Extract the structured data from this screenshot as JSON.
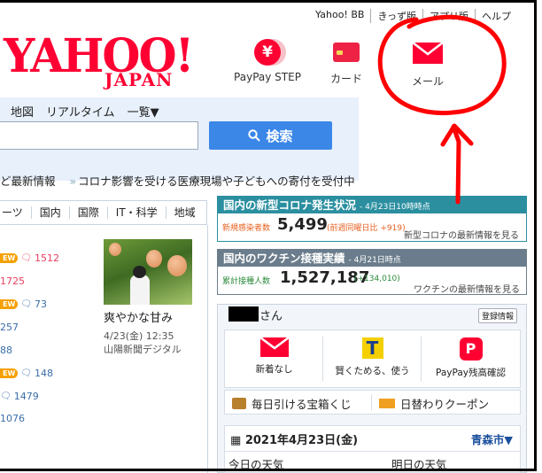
{
  "toplinks": [
    "Yahoo! BB",
    "きっず版",
    "アプリ版",
    "ヘルプ"
  ],
  "logo": {
    "main": "YAHOO!",
    "sub": "JAPAN"
  },
  "services": [
    {
      "label": "PayPay STEP",
      "icon": "paypay-step-icon",
      "glyph": "¥"
    },
    {
      "label": "カード",
      "icon": "card-icon"
    },
    {
      "label": "メール",
      "icon": "mail-icon"
    }
  ],
  "nav": {
    "links": [
      "地図",
      "リアルタイム",
      "一覧▼"
    ]
  },
  "search": {
    "placeholder": "",
    "button": "検索"
  },
  "ticker": {
    "left": "ど最新情報",
    "right": "コロナ影響を受ける医療現場や子どもへの寄付を受付中"
  },
  "categories": [
    "ーツ",
    "国内",
    "国際",
    "IT・科学",
    "地域"
  ],
  "news_rows": [
    {
      "new": "EW",
      "comments": "1512",
      "color": "red"
    },
    {
      "new": "",
      "comments": "1725",
      "color": "red",
      "no_icon": true
    },
    {
      "new": "EW",
      "comments": "73",
      "color": "blue"
    },
    {
      "new": "",
      "comments": "257",
      "color": "blue",
      "no_icon": true
    },
    {
      "new": "",
      "comments": "88",
      "color": "blue",
      "no_icon": true
    },
    {
      "new": "EW",
      "comments": "148",
      "color": "blue"
    },
    {
      "new": "",
      "comments": "1479",
      "color": "blue"
    },
    {
      "new": "",
      "comments": "1076",
      "color": "blue",
      "no_icon": true
    }
  ],
  "photo_article": {
    "title": "爽やかな甘み",
    "time": "4/23(金) 12:35",
    "source": "山陽新聞デジタル"
  },
  "covid": {
    "header": "国内の新型コロナ発生状況",
    "timestamp": "- 4月23日10時時点",
    "label": "新規感染者数",
    "value": "5,499",
    "diff": "(前週同曜日比 +919)",
    "link": "新型コロナの最新情報を見る"
  },
  "vaccine": {
    "header": "国内のワクチン接種実績",
    "timestamp": "- 4月21日時点",
    "label": "累計接種人数",
    "value": "1,527,187",
    "diff": "(+134,010)",
    "link": "ワクチンの最新情報を見る"
  },
  "user": {
    "suffix": "さん",
    "login_info": "登録情報",
    "tiles": [
      {
        "label": "新着なし",
        "icon": "mail-icon"
      },
      {
        "label": "賢くためる、使う",
        "icon": "t-point-icon",
        "glyph": "T"
      },
      {
        "label": "PayPay残高確認",
        "icon": "paypay-icon",
        "glyph": "P"
      }
    ],
    "links": [
      {
        "label": "毎日引ける宝箱くじ",
        "icon": "treasure-chest-icon"
      },
      {
        "label": "日替わりクーポン",
        "icon": "coupon-icon"
      }
    ],
    "date": "2021年4月23日(金)",
    "city": "青森市▼",
    "weather_today": "今日の天気",
    "weather_tomorrow": "明日の天気"
  },
  "colors": {
    "yahoo_red": "#ff0033",
    "search_blue": "#3b87e8",
    "covid_teal": "#2b8fa0",
    "vaccine_gray": "#6b7d8c",
    "annotation_red": "#ff0000"
  }
}
